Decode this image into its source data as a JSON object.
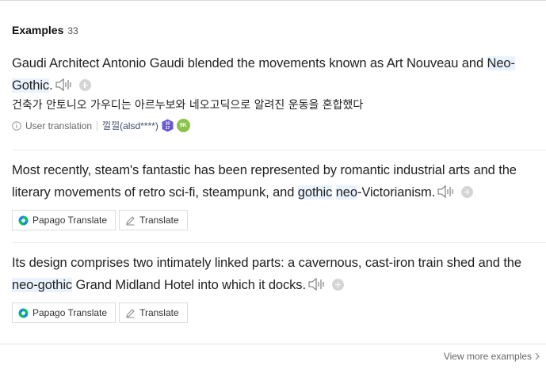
{
  "header": {
    "title": "Examples",
    "count": "33"
  },
  "examples": [
    {
      "pre": "Gaudi Architect Antonio Gaudi blended the movements known as Art Nouveau and ",
      "hl1": "Neo-Gothic",
      "post": ".",
      "translation": "건축가 안토니오 가우디는 아르누보와 네오고딕으로 알려진 운동을 혼합했다",
      "source_label": "User translation",
      "user": "낄낄(alsd****)",
      "badge_level": "20\n17",
      "badge_count": "9K"
    },
    {
      "pre": "Most recently, steam's fantastic has been represented by romantic industrial arts and the literary movements of retro sci-fi, steampunk, and ",
      "hl1": "gothic",
      "mid": " ",
      "hl2": "neo",
      "post": "-Victorianism.",
      "papago_label": "Papago Translate",
      "translate_label": "Translate"
    },
    {
      "pre": "Its design comprises two intimately linked parts: a cavernous, cast-iron train shed and the ",
      "hl1": "neo-gothic",
      "post": " Grand Midland Hotel into which it docks.",
      "papago_label": "Papago Translate",
      "translate_label": "Translate"
    }
  ],
  "footer": {
    "more_label": "View more examples"
  },
  "colors": {
    "highlight": "#eaf3fd",
    "badge_green": "#8bc34a",
    "badge_purple": "#6a5acd",
    "papago_green": "#03c75a",
    "papago_blue": "#1e88e5"
  },
  "icons": [
    "speaker-icon",
    "add-icon",
    "info-icon",
    "papago-icon",
    "pencil-icon",
    "chevron-right-icon"
  ]
}
